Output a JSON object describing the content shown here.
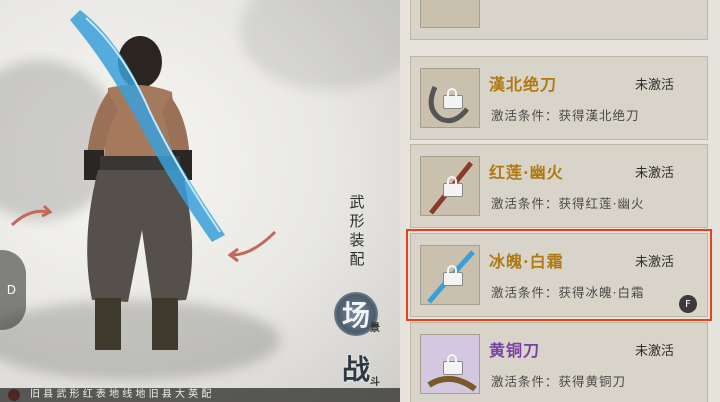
{
  "scene": {
    "side_handle_label": "D",
    "vertical_menu_label": "武形装配",
    "seals": [
      {
        "big": "场",
        "small": "景"
      },
      {
        "big": "战",
        "small": "斗"
      }
    ],
    "bottom_text": "旧 县 武 形 红 表 地 线 地 旧 县 大 英 配"
  },
  "weapons": [
    {
      "title": "漢北绝刀",
      "status": "未激活",
      "condition": "激活条件：获得漢北绝刀",
      "title_color": "#b07a12"
    },
    {
      "title": "红莲·幽火",
      "status": "未激活",
      "condition": "激活条件：获得红莲·幽火",
      "title_color": "#b07a12"
    },
    {
      "title": "冰魄·白霜",
      "status": "未激活",
      "condition": "激活条件：获得冰魄·白霜",
      "title_color": "#b07a12"
    },
    {
      "title": "黄铜刀",
      "status": "未激活",
      "condition": "激活条件：获得黄铜刀",
      "title_color": "#7a3fa6"
    }
  ],
  "selected_badge": "F",
  "colors": {
    "highlight": "#e8401c",
    "panel_bg": "#e6e3dc",
    "card_bg": "#d9d4c9"
  }
}
